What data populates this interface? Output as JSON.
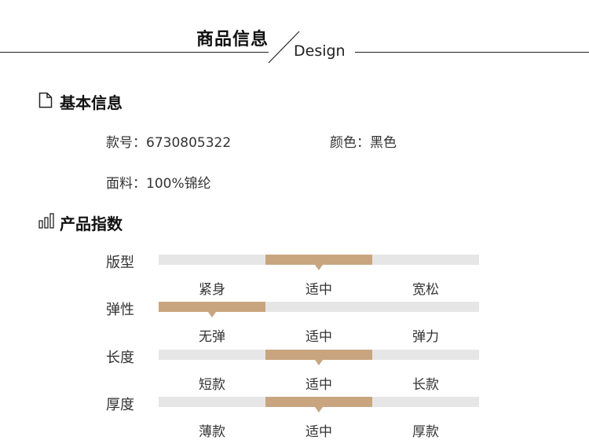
{
  "header": {
    "title": "商品信息",
    "subtitle": "Design"
  },
  "basic": {
    "heading": "基本信息",
    "fields": [
      {
        "label": "款号：",
        "value": "6730805322"
      },
      {
        "label": "颜色：",
        "value": "黑色"
      },
      {
        "label": "面料：",
        "value": "100%锦纶"
      }
    ]
  },
  "index": {
    "heading": "产品指数",
    "rows": [
      {
        "label": "版型",
        "options": [
          "紧身",
          "适中",
          "宽松"
        ],
        "selected": 1
      },
      {
        "label": "弹性",
        "options": [
          "无弹",
          "适中",
          "弹力"
        ],
        "selected": 0
      },
      {
        "label": "长度",
        "options": [
          "短款",
          "适中",
          "长款"
        ],
        "selected": 1
      },
      {
        "label": "厚度",
        "options": [
          "薄款",
          "适中",
          "厚款"
        ],
        "selected": 1
      }
    ]
  },
  "colors": {
    "accent": "#c8a57f",
    "track": "#e6e6e6",
    "text": "#333333"
  },
  "icons": {
    "basic": "document-icon",
    "index": "bar-chart-icon"
  }
}
